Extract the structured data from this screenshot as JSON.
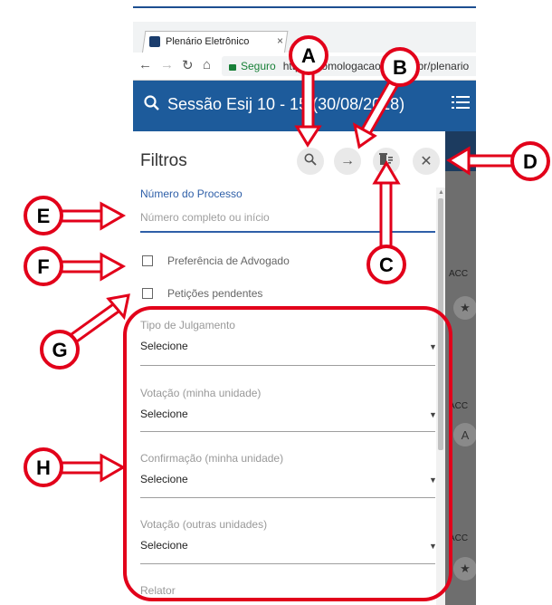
{
  "browser": {
    "tab_title": "Plenário Eletrônico",
    "tab_close": "×",
    "secure_label": "Seguro",
    "url": "https://homologacao.cnj.jus.br/plenario",
    "nav_icons": [
      "back-icon",
      "forward-icon",
      "reload-icon",
      "home-icon"
    ]
  },
  "app": {
    "title": "Sessão Esij 10 - 15 (30/08/2018)",
    "colors": {
      "accent": "#1d5b9b",
      "label_blue": "#2e5fa8",
      "callout_red": "#e2001a"
    }
  },
  "filters": {
    "title": "Filtros",
    "actions": [
      "search-icon",
      "arrow-right-icon",
      "clear-filter-icon",
      "close-icon"
    ],
    "process_number": {
      "label": "Número do Processo",
      "placeholder": "Número completo ou início",
      "value": ""
    },
    "checkboxes": [
      {
        "label": "Preferência de Advogado",
        "checked": false
      },
      {
        "label": "Petições pendentes",
        "checked": false
      }
    ],
    "selects": [
      {
        "label": "Tipo de Julgamento",
        "value": "Selecione"
      },
      {
        "label": "Votação (minha unidade)",
        "value": "Selecione"
      },
      {
        "label": "Confirmação (minha unidade)",
        "value": "Selecione"
      },
      {
        "label": "Votação (outras unidades)",
        "value": "Selecione"
      },
      {
        "label": "Relator",
        "value": ""
      }
    ]
  },
  "background_list": {
    "item_label": "ACC",
    "icons": [
      "star-icon",
      "vote-icon",
      "star-icon"
    ]
  },
  "callouts": [
    "A",
    "B",
    "C",
    "D",
    "E",
    "F",
    "G",
    "H"
  ]
}
